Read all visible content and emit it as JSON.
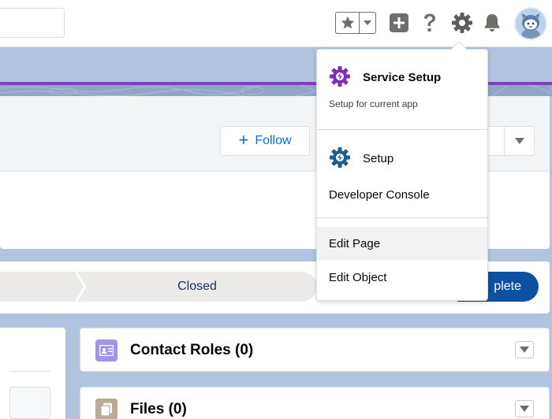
{
  "header": {
    "search_placeholder": "",
    "icons": [
      "star-icon",
      "chevron-down-icon",
      "plus-icon",
      "help-icon",
      "gear-icon",
      "bell-icon",
      "avatar"
    ]
  },
  "highlights": {
    "follow_label": "Follow"
  },
  "path": {
    "stage_label": "Closed",
    "complete_label": "plete"
  },
  "related": {
    "contact_roles_title": "Contact Roles (0)",
    "files_title": "Files (0)"
  },
  "setup_menu": {
    "service_setup_title": "Service Setup",
    "service_setup_sub": "Setup for current app",
    "setup_title": "Setup",
    "developer_console": "Developer Console",
    "edit_page": "Edit Page",
    "edit_object": "Edit Object"
  },
  "colors": {
    "brand_blue": "#0070d2",
    "purple_accent": "#7f3fbf",
    "service_gear": "#7e2fb8",
    "setup_gear": "#1b5f8c",
    "contact_roles_icon": "#a094ed",
    "files_icon": "#baac93"
  }
}
